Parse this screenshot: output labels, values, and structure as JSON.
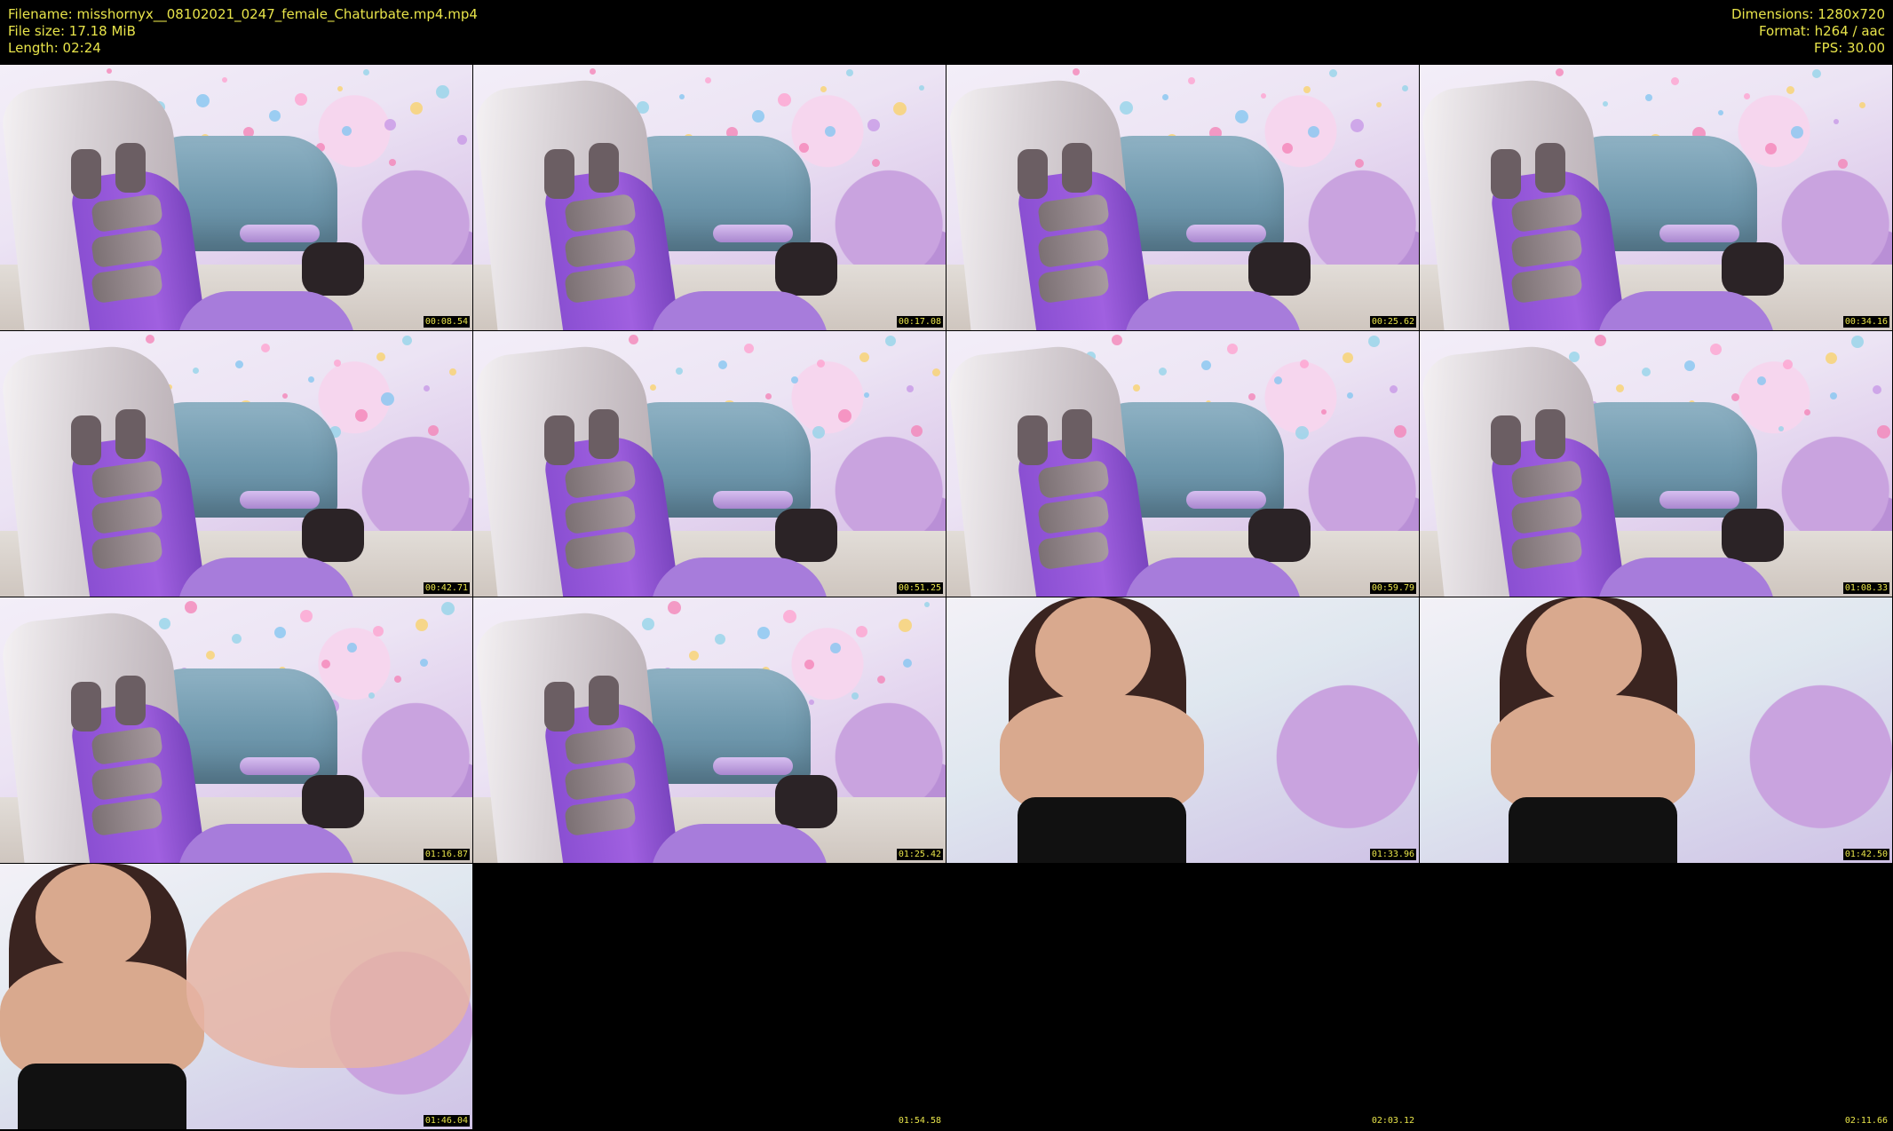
{
  "header": {
    "filename_line": "Filename: misshornyx__08102021_0247_female_Chaturbate.mp4.mp4",
    "filesize_line": "File size: 17.18 MiB",
    "length_line": "Length: 02:24",
    "dimensions_line": "Dimensions: 1280x720",
    "format_line": "Format: h264 / aac",
    "fps_line": "FPS: 30.00"
  },
  "thumbnails": [
    {
      "timestamp": "00:08.54",
      "scene": "chair"
    },
    {
      "timestamp": "00:17.08",
      "scene": "chair"
    },
    {
      "timestamp": "00:25.62",
      "scene": "chair"
    },
    {
      "timestamp": "00:34.16",
      "scene": "chair"
    },
    {
      "timestamp": "00:42.71",
      "scene": "chair"
    },
    {
      "timestamp": "00:51.25",
      "scene": "chair"
    },
    {
      "timestamp": "00:59.79",
      "scene": "chair"
    },
    {
      "timestamp": "01:08.33",
      "scene": "chair"
    },
    {
      "timestamp": "01:16.87",
      "scene": "chair"
    },
    {
      "timestamp": "01:25.42",
      "scene": "chair"
    },
    {
      "timestamp": "01:33.96",
      "scene": "person"
    },
    {
      "timestamp": "01:42.50",
      "scene": "person"
    },
    {
      "timestamp": "01:46.04",
      "scene": "person-hand"
    },
    {
      "timestamp": "01:54.58",
      "scene": "black"
    },
    {
      "timestamp": "02:03.12",
      "scene": "black"
    },
    {
      "timestamp": "02:11.66",
      "scene": "black"
    }
  ],
  "colors": {
    "background": "#000000",
    "text": "#e8e44a"
  }
}
